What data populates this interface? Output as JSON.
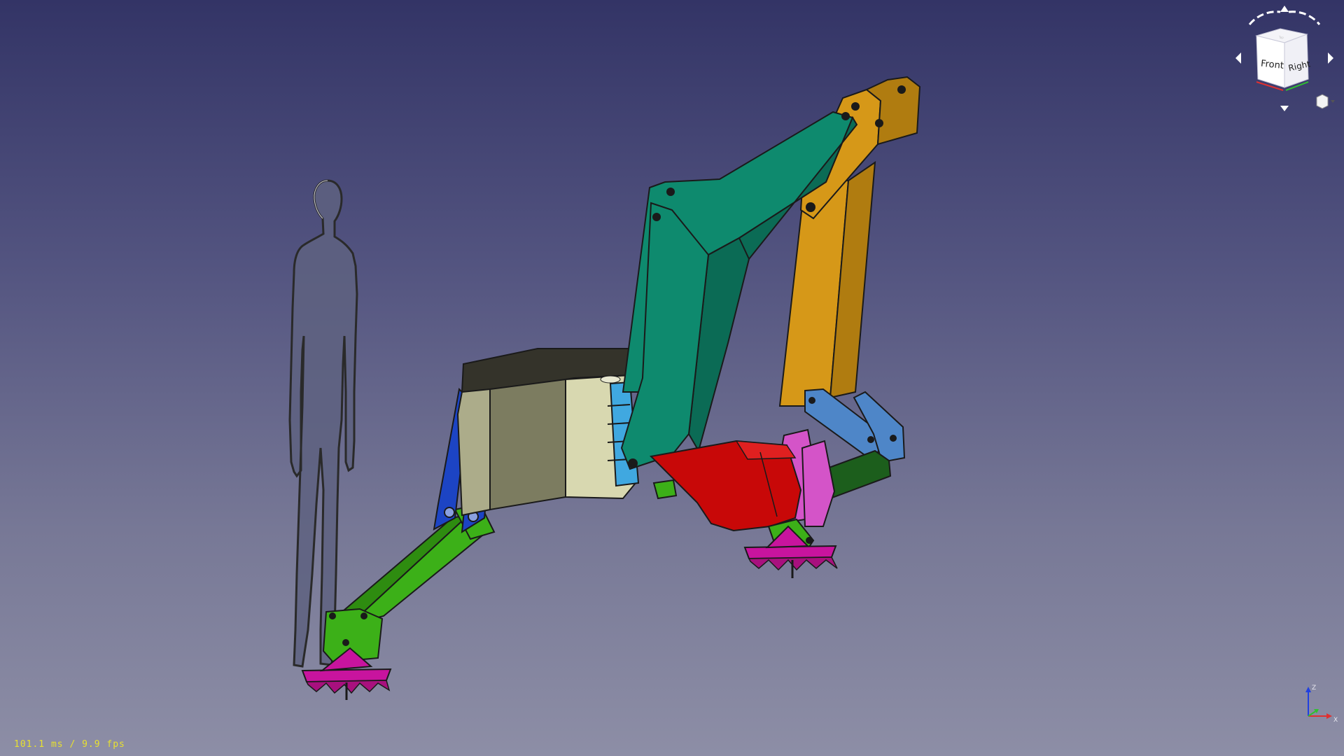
{
  "view": {
    "fps_readout": "101.1 ms / 9.9 fps",
    "background_top": "#333466",
    "background_bottom": "#8d8ea6"
  },
  "navcube": {
    "front_label": "Front",
    "right_label": "Right",
    "top_label": "Top"
  },
  "axes": {
    "z_label": "Z",
    "x_label": "X",
    "z_color": "#2040e0",
    "x_color": "#e03030",
    "y_color": "#30c030"
  },
  "model": {
    "colors": {
      "human_silhouette": "#5e6180",
      "base_top": "#34332a",
      "base_left": "#acac8a",
      "base_front": "#7c7c60",
      "base_right": "#d8d8b0",
      "left_arm": "#3cb018",
      "outrigger_bracket": "#1c44c4",
      "boom": "#0e8a6e",
      "boom_shadow": "#0b6b55",
      "dipper": "#d69818",
      "dipper_shadow": "#b07c10",
      "link": "#4e86c8",
      "dark_link": "#1c5e1c",
      "side_plates": "#d454c8",
      "bucket": "#c80808",
      "pad": "#c8149e",
      "mount_small": "#40a8e0"
    }
  }
}
